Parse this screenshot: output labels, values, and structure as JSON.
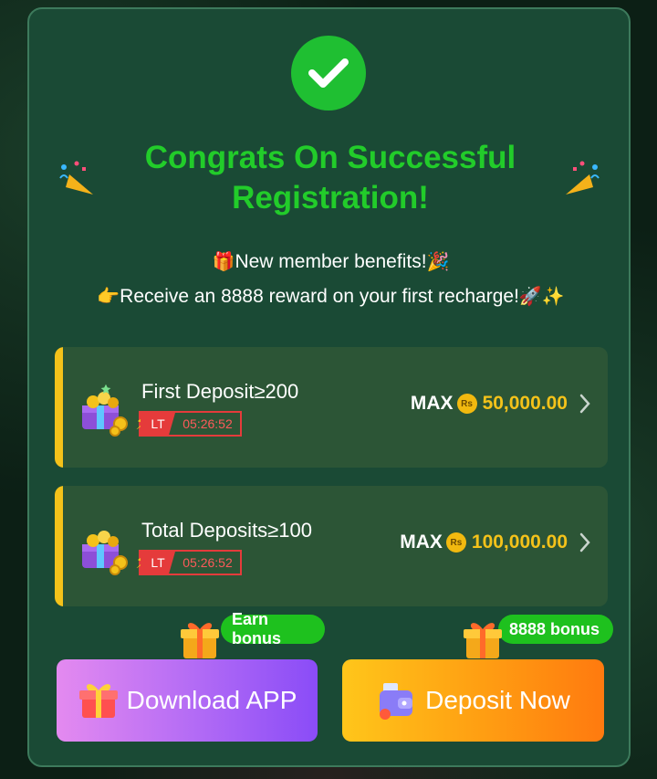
{
  "modal": {
    "title": "Congrats On Successful Registration!",
    "benefit_line_1": {
      "emoji_left": "🎁",
      "text": "New member benefits!",
      "emoji_right": "🎉"
    },
    "benefit_line_2": {
      "emoji_left": "👉",
      "text": "Receive an 8888 reward on your first recharge!",
      "emoji_right": "🚀✨"
    },
    "icons": {
      "check": "check-icon",
      "popper": "party-popper-icon"
    }
  },
  "cards": [
    {
      "label": "First Deposit≥200",
      "timer_prefix": "LT",
      "timer": "05:26:52",
      "max_label": "MAX",
      "currency": "Rs",
      "amount": "50,000.00"
    },
    {
      "label": "Total Deposits≥100",
      "timer_prefix": "LT",
      "timer": "05:26:52",
      "max_label": "MAX",
      "currency": "Rs",
      "amount": "100,000.00"
    }
  ],
  "buttons": {
    "download": {
      "label": "Download APP",
      "badge": "Earn bonus"
    },
    "deposit": {
      "label": "Deposit Now",
      "badge": "8888 bonus"
    }
  },
  "colors": {
    "modal_bg": "#1a4a35",
    "accent_green": "#22cc2a",
    "card_bg": "#2c5536",
    "gold": "#f4c21a",
    "timer_red": "#e53b3b"
  }
}
